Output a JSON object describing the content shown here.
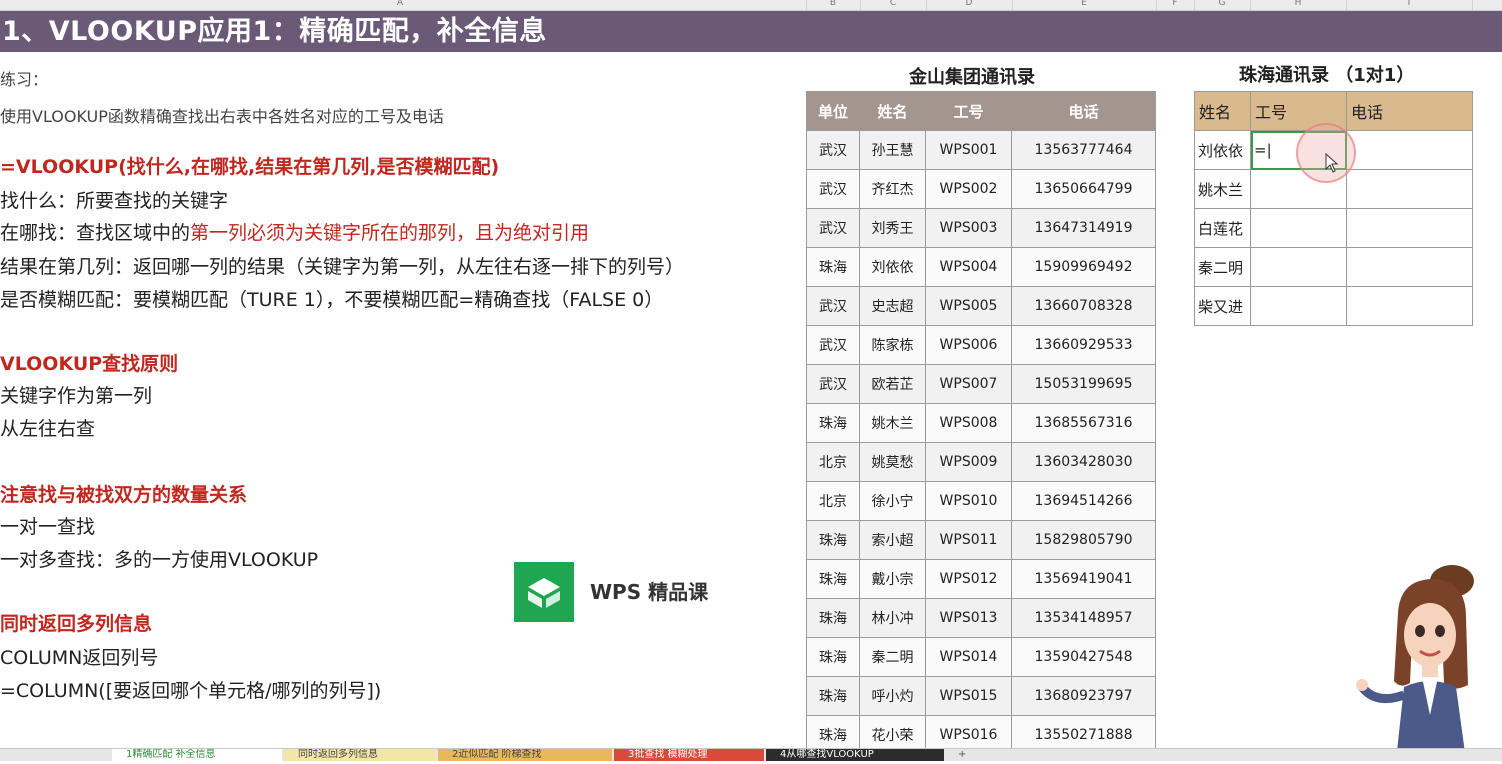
{
  "sheet": {
    "column_letters": [
      "A",
      "B",
      "C",
      "D",
      "E",
      "F",
      "G",
      "H",
      "I"
    ],
    "title": "1、VLOOKUP应用1：精确匹配，补全信息"
  },
  "notes": {
    "practice_label": "练习：",
    "practice_text": "使用VLOOKUP函数精确查找出右表中各姓名对应的工号及电话",
    "formula": "=VLOOKUP(找什么,在哪找,结果在第几列,是否模糊匹配)",
    "find_what": "找什么：所要查找的关键字",
    "where_prefix": "在哪找：查找区域中的",
    "where_red": "第一列必须为关键字所在的那列，且为绝对引用",
    "which_col": "结果在第几列：返回哪一列的结果（关键字为第一列，从左往右逐一排下的列号）",
    "fuzzy": "是否模糊匹配：要模糊匹配（TURE 1），不要模糊匹配=精确查找（FALSE 0）",
    "principle_head": "VLOOKUP查找原则",
    "principle_1": "关键字作为第一列",
    "principle_2": "从左往右查",
    "quantity_head": "注意找与被找双方的数量关系",
    "quantity_1": "一对一查找",
    "quantity_2": "一对多查找：多的一方使用VLOOKUP",
    "multi_head": "同时返回多列信息",
    "multi_1": "COLUMN返回列号",
    "multi_2": "=COLUMN([要返回哪个单元格/哪列的列号])"
  },
  "main_table": {
    "title": "金山集团通讯录",
    "headers": [
      "单位",
      "姓名",
      "工号",
      "电话"
    ],
    "rows": [
      [
        "武汉",
        "孙王慧",
        "WPS001",
        "13563777464"
      ],
      [
        "武汉",
        "齐红杰",
        "WPS002",
        "13650664799"
      ],
      [
        "武汉",
        "刘秀王",
        "WPS003",
        "13647314919"
      ],
      [
        "珠海",
        "刘依依",
        "WPS004",
        "15909969492"
      ],
      [
        "武汉",
        "史志超",
        "WPS005",
        "13660708328"
      ],
      [
        "武汉",
        "陈家栋",
        "WPS006",
        "13660929533"
      ],
      [
        "武汉",
        "欧若芷",
        "WPS007",
        "15053199695"
      ],
      [
        "珠海",
        "姚木兰",
        "WPS008",
        "13685567316"
      ],
      [
        "北京",
        "姚莫愁",
        "WPS009",
        "13603428030"
      ],
      [
        "北京",
        "徐小宁",
        "WPS010",
        "13694514266"
      ],
      [
        "珠海",
        "索小超",
        "WPS011",
        "15829805790"
      ],
      [
        "珠海",
        "戴小宗",
        "WPS012",
        "13569419041"
      ],
      [
        "珠海",
        "林小冲",
        "WPS013",
        "13534148957"
      ],
      [
        "珠海",
        "秦二明",
        "WPS014",
        "13590427548"
      ],
      [
        "珠海",
        "呼小灼",
        "WPS015",
        "13680923797"
      ],
      [
        "珠海",
        "花小荣",
        "WPS016",
        "13550271888"
      ]
    ]
  },
  "zhuhai_table": {
    "title": "珠海通讯录 （1对1）",
    "headers": [
      "姓名",
      "工号",
      "电话"
    ],
    "rows": [
      [
        "刘依依",
        "=|",
        ""
      ],
      [
        "姚木兰",
        "",
        ""
      ],
      [
        "白莲花",
        "",
        ""
      ],
      [
        "秦二明",
        "",
        ""
      ],
      [
        "柴又进",
        "",
        ""
      ]
    ]
  },
  "logo": {
    "text": "WPS 精品课",
    "color": "#1fa651"
  },
  "sheet_tabs": [
    {
      "label": "1精确匹配 补全信息",
      "color": "#ffffff",
      "text_color": "#2e8b3a"
    },
    {
      "label": "同时返回多列信息",
      "color": "#f3e6a6",
      "text_color": "#444444"
    },
    {
      "label": "2近似匹配 阶梯查找",
      "color": "#e9b85a",
      "text_color": "#444444"
    },
    {
      "label": "3批查找 模糊处理",
      "color": "#d94a3a",
      "text_color": "#ffffff"
    },
    {
      "label": "4从哪查找VLOOKUP",
      "color": "#2c2c2c",
      "text_color": "#ffffff"
    }
  ],
  "add_sheet_label": "+",
  "colors": {
    "title_bar": "#6b5a77",
    "accent_red": "#c0281f",
    "main_header": "#a4958f",
    "zh_header": "#d9b98e"
  }
}
